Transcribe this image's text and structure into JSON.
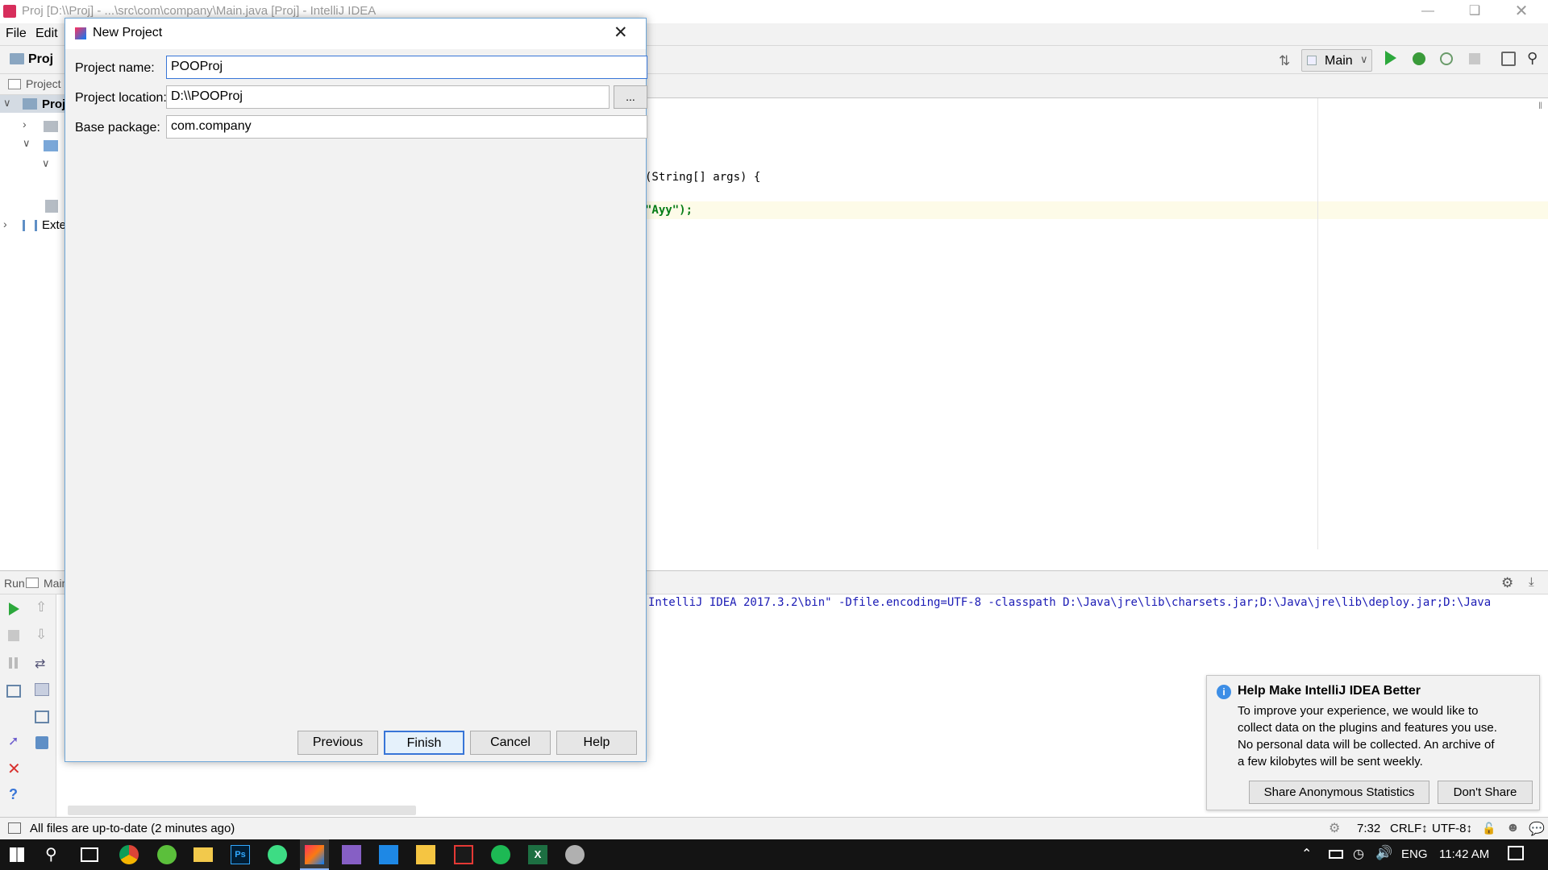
{
  "window": {
    "title": "Proj [D:\\\\Proj] - ...\\src\\com\\company\\Main.java [Proj] - IntelliJ IDEA",
    "minimize_icon": "minimize-icon",
    "maximize_icon": "restore-icon",
    "close_icon": "close-icon"
  },
  "menubar": {
    "items": [
      "File",
      "Edit"
    ]
  },
  "navbar": {
    "project_crumb": "Proj",
    "run_config": "Main"
  },
  "project_panel": {
    "header": "Project",
    "tree": {
      "root": "Proj",
      "external": "Exte"
    }
  },
  "editor": {
    "line1": "(String[] args) {",
    "line2": "\"Ayy\");"
  },
  "run_panel": {
    "tab_run": "Run",
    "tab_main": "Main",
    "output": "IntelliJ IDEA 2017.3.2\\bin\" -Dfile.encoding=UTF-8 -classpath D:\\Java\\jre\\lib\\charsets.jar;D:\\Java\\jre\\lib\\deploy.jar;D:\\Java"
  },
  "statusbar": {
    "message": "All files are up-to-date (2 minutes ago)",
    "position": "7:32",
    "line_sep": "CRLF↕",
    "encoding": "UTF-8↕"
  },
  "dialog": {
    "title": "New Project",
    "project_name_label": "Project name:",
    "project_name_value": "POOProj",
    "project_location_label": "Project location:",
    "project_location_value": "D:\\\\POOProj",
    "browse_label": "...",
    "base_package_label": "Base package:",
    "base_package_value": "com.company",
    "buttons": {
      "previous": "Previous",
      "finish": "Finish",
      "cancel": "Cancel",
      "help": "Help"
    }
  },
  "notification": {
    "title": "Help Make IntelliJ IDEA Better",
    "body_lines": [
      "To improve your experience, we would like to",
      "collect data on the plugins and features you use.",
      "No personal data will be collected. An archive of",
      "a few kilobytes will be sent weekly."
    ],
    "share_button": "Share Anonymous Statistics",
    "dont_share_button": "Don't Share"
  },
  "taskbar": {
    "language": "ENG",
    "time": "11:42 AM"
  },
  "colors": {
    "accent": "#3875d7",
    "run_green": "#2ca83c",
    "output_blue": "#1b1bb5",
    "dialog_border": "#6fa7d8"
  }
}
